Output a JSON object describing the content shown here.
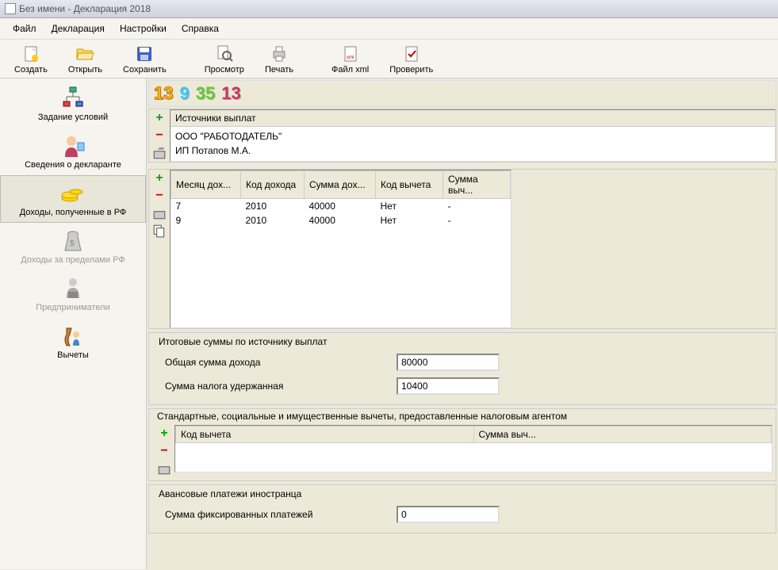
{
  "window": {
    "title": "Без имени - Декларация 2018"
  },
  "menu": {
    "file": "Файл",
    "decl": "Декларация",
    "settings": "Настройки",
    "help": "Справка"
  },
  "toolbar": {
    "create": "Создать",
    "open": "Открыть",
    "save": "Сохранить",
    "preview": "Просмотр",
    "print": "Печать",
    "xml": "Файл xml",
    "check": "Проверить"
  },
  "sidebar": {
    "conditions": "Задание условий",
    "declarant": "Сведения о декларанте",
    "income_rf": "Доходы, полученные в РФ",
    "income_abroad": "Доходы за пределами РФ",
    "entrepreneurs": "Предприниматели",
    "deductions": "Вычеты"
  },
  "badges": {
    "b1": "13",
    "b2": "9",
    "b3": "35",
    "b4": "13"
  },
  "sources": {
    "header": "Источники выплат",
    "rows": [
      "ООО \"РАБОТОДАТЕЛЬ\"",
      "ИП Потапов М.А."
    ]
  },
  "income_grid": {
    "cols": [
      "Месяц дох...",
      "Код дохода",
      "Сумма дох...",
      "Код вычета",
      "Сумма выч..."
    ],
    "rows": [
      {
        "month": "7",
        "code": "2010",
        "sum": "40000",
        "dcode": "Нет",
        "dsum": "-"
      },
      {
        "month": "9",
        "code": "2010",
        "sum": "40000",
        "dcode": "Нет",
        "dsum": "-"
      }
    ]
  },
  "totals": {
    "title": "Итоговые суммы по источнику выплат",
    "total_label": "Общая сумма дохода",
    "total_value": "80000",
    "tax_label": "Сумма налога удержанная",
    "tax_value": "10400"
  },
  "deductions_section": {
    "title": "Стандартные, социальные и имущественные вычеты, предоставленные налоговым агентом",
    "cols": [
      "Код вычета",
      "Сумма выч..."
    ]
  },
  "advance": {
    "title": "Авансовые платежи иностранца",
    "label": "Сумма фиксированных платежей",
    "value": "0"
  }
}
